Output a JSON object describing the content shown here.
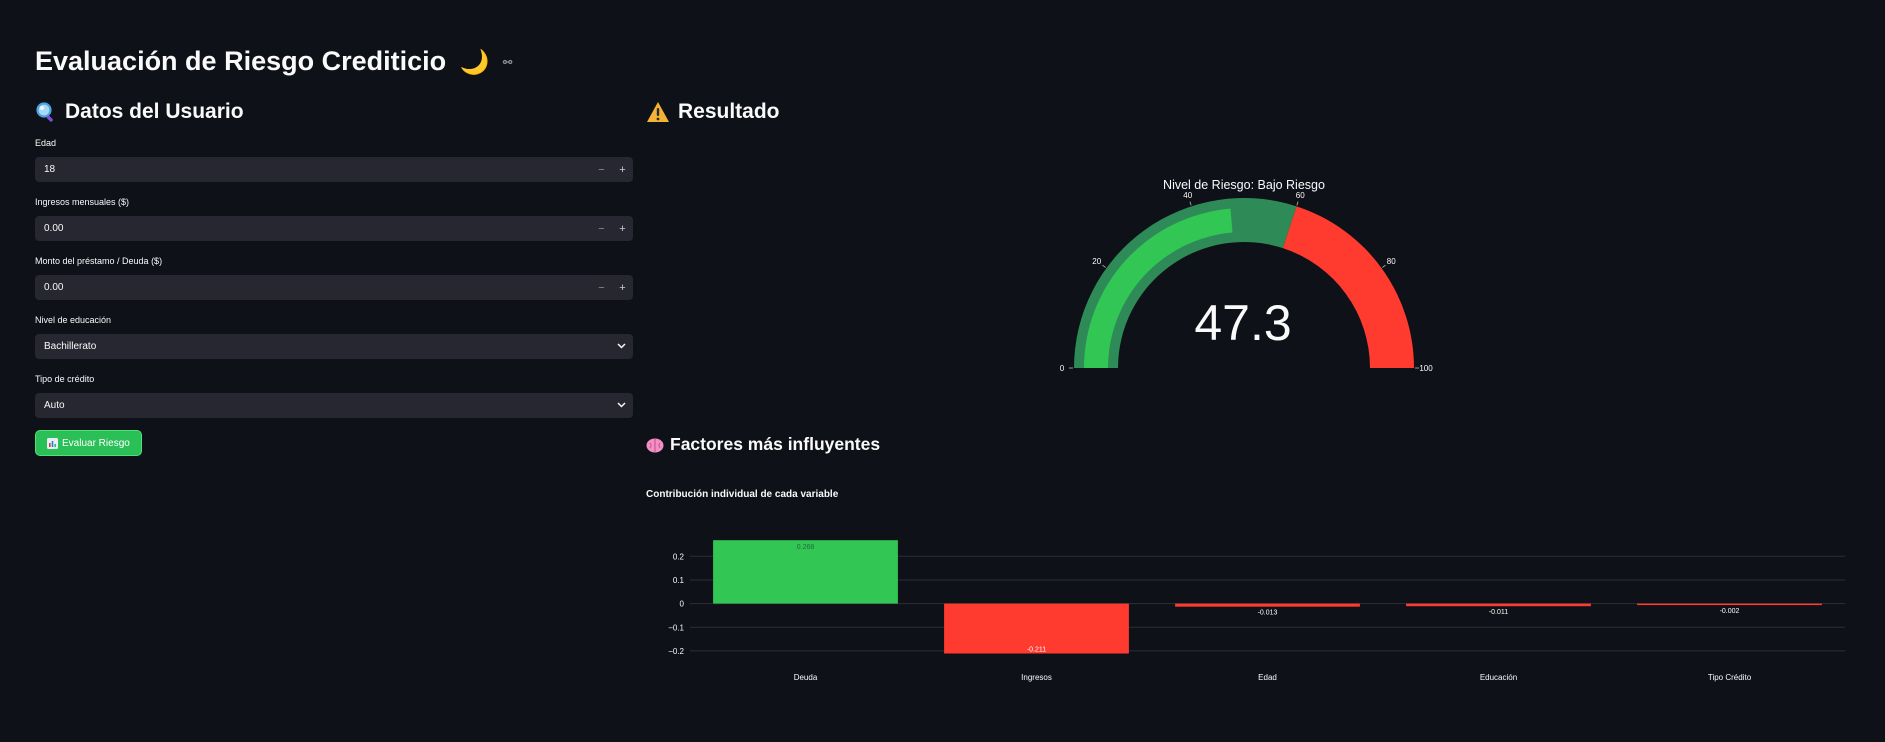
{
  "app": {
    "title": "Evaluación de Riesgo Crediticio",
    "title_emoji": "🌙",
    "link_glyph": "⚯"
  },
  "form": {
    "heading": "Datos del Usuario",
    "heading_icon": "magnifier-icon",
    "fields": [
      {
        "label": "Edad",
        "value": "18",
        "type": "number"
      },
      {
        "label": "Ingresos mensuales ($)",
        "value": "0.00",
        "type": "number"
      },
      {
        "label": "Monto del préstamo / Deuda ($)",
        "value": "0.00",
        "type": "number"
      },
      {
        "label": "Nivel de educación",
        "value": "Bachillerato",
        "type": "select"
      },
      {
        "label": "Tipo de crédito",
        "value": "Auto",
        "type": "select"
      }
    ],
    "stepper_minus": "−",
    "stepper_plus": "+",
    "submit_label": "Evaluar Riesgo",
    "submit_icon": "bar-chart-icon"
  },
  "result": {
    "heading": "Resultado",
    "heading_icon": "warning-icon"
  },
  "gauge": {
    "title": "Nivel de Riesgo: Bajo Riesgo",
    "value": 47.3,
    "value_text": "47.3",
    "min": 0,
    "max": 100,
    "ticks": [
      0,
      20,
      40,
      60,
      80,
      100
    ],
    "steps": [
      {
        "from": 0,
        "to": 60,
        "color": "#2e8b57"
      },
      {
        "from": 60,
        "to": 100,
        "color": "#ff3b30"
      }
    ],
    "bar_color": "#32c755"
  },
  "factors": {
    "heading": "Factores más influyentes",
    "heading_icon": "brain-icon"
  },
  "chart_data": {
    "type": "bar",
    "title": "Contribución individual de cada variable",
    "categories": [
      "Deuda",
      "Ingresos",
      "Edad",
      "Educación",
      "Tipo Crédito"
    ],
    "values": [
      0.268,
      -0.211,
      -0.013,
      -0.011,
      -0.002
    ],
    "value_labels": [
      "0.268",
      "-0.211",
      "-0.013",
      "-0.011",
      "-0.002"
    ],
    "y_ticks": [
      0.2,
      0.1,
      0,
      -0.1,
      -0.2
    ],
    "y_tick_labels": [
      "0.2",
      "0.1",
      "0",
      "−0.1",
      "−0.2"
    ],
    "ylim": [
      -0.23,
      0.29
    ],
    "positive_color": "#32c755",
    "negative_color": "#ff3b30",
    "grid": true,
    "xlabel": "",
    "ylabel": ""
  }
}
